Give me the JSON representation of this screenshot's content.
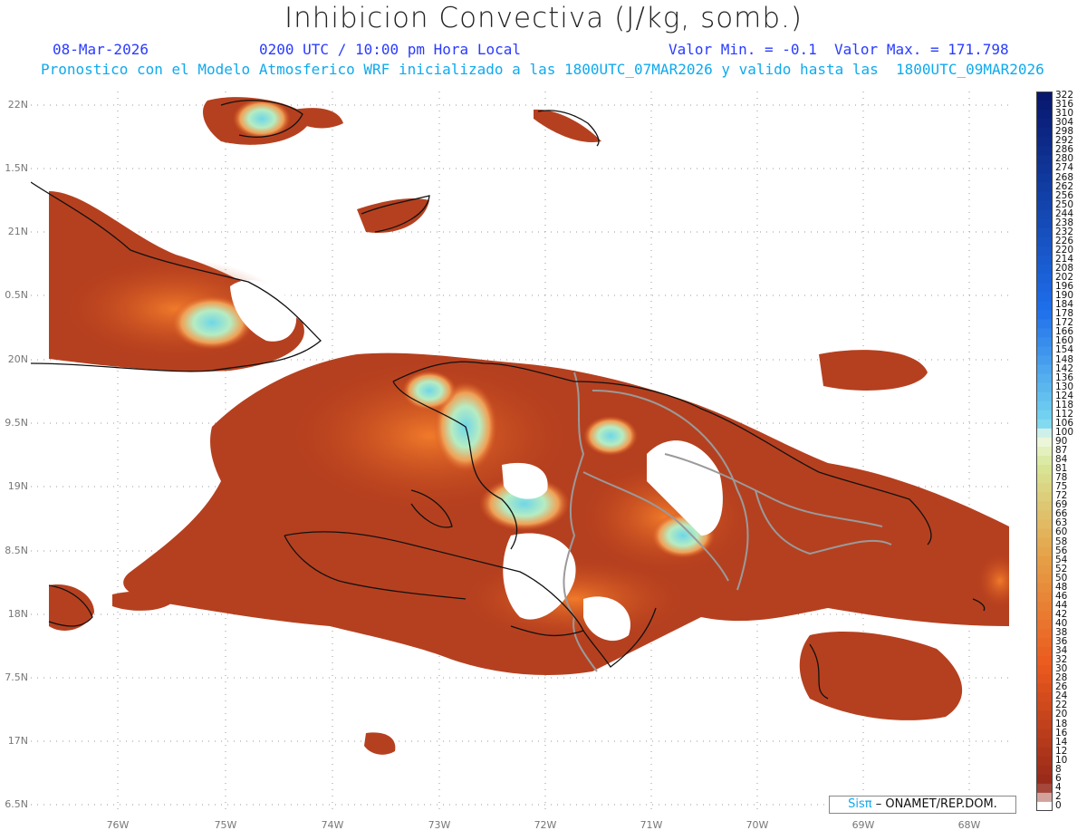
{
  "header": {
    "title": "Inhibicion Convectiva (J/kg, somb.)",
    "date": "08-Mar-2026",
    "time": "0200 UTC / 10:00 pm Hora Local",
    "minmax": "Valor Min. = -0.1  Valor Max. = 171.798",
    "model_line": "Pronostico con el Modelo Atmosferico WRF inicializado a las 1800UTC_07MAR2026 y valido hasta las  1800UTC_09MAR2026"
  },
  "axes": {
    "lat_labels": [
      "22N",
      "1.5N",
      "21N",
      "0.5N",
      "20N",
      "9.5N",
      "19N",
      "8.5N",
      "18N",
      "7.5N",
      "17N",
      "6.5N"
    ],
    "lon_labels": [
      "76W",
      "75W",
      "74W",
      "73W",
      "72W",
      "71W",
      "70W",
      "69W",
      "68W"
    ]
  },
  "legend": {
    "labels": [
      "322",
      "316",
      "310",
      "304",
      "298",
      "292",
      "286",
      "280",
      "274",
      "268",
      "262",
      "256",
      "250",
      "244",
      "238",
      "232",
      "226",
      "220",
      "214",
      "208",
      "202",
      "196",
      "190",
      "184",
      "178",
      "172",
      "166",
      "160",
      "154",
      "148",
      "142",
      "136",
      "130",
      "124",
      "118",
      "112",
      "106",
      "100",
      "90",
      "87",
      "84",
      "81",
      "78",
      "75",
      "72",
      "69",
      "66",
      "63",
      "60",
      "58",
      "56",
      "54",
      "52",
      "50",
      "48",
      "46",
      "44",
      "42",
      "40",
      "38",
      "36",
      "34",
      "32",
      "30",
      "28",
      "26",
      "24",
      "22",
      "20",
      "18",
      "16",
      "14",
      "12",
      "10",
      "8",
      "6",
      "4",
      "2",
      "0"
    ]
  },
  "credit": {
    "sis": "Sisπ",
    "org": "– ONAMET/REP.DOM."
  },
  "colors": {
    "land_field": "#b5401f",
    "mid_field": "#d8531e",
    "high_field": "#9be6cd",
    "peak_field": "#6fd6e8",
    "coast": "#111111",
    "border": "#9a9a9a"
  }
}
